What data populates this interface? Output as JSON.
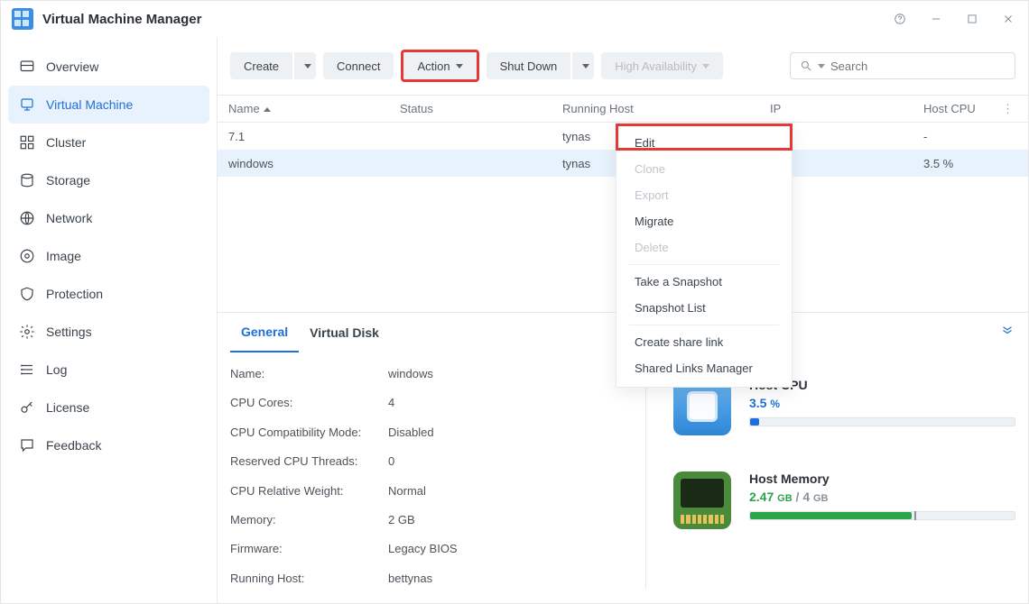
{
  "app": {
    "title": "Virtual Machine Manager"
  },
  "sidebar": {
    "items": [
      {
        "label": "Overview"
      },
      {
        "label": "Virtual Machine"
      },
      {
        "label": "Cluster"
      },
      {
        "label": "Storage"
      },
      {
        "label": "Network"
      },
      {
        "label": "Image"
      },
      {
        "label": "Protection"
      },
      {
        "label": "Settings"
      },
      {
        "label": "Log"
      },
      {
        "label": "License"
      },
      {
        "label": "Feedback"
      }
    ],
    "active_index": 1
  },
  "toolbar": {
    "create": "Create",
    "connect": "Connect",
    "action": "Action",
    "shutdown": "Shut Down",
    "ha": "High Availability",
    "search_placeholder": "Search"
  },
  "action_menu": {
    "items": [
      {
        "label": "Edit",
        "disabled": false
      },
      {
        "label": "Clone",
        "disabled": true
      },
      {
        "label": "Export",
        "disabled": true
      },
      {
        "label": "Migrate",
        "disabled": false
      },
      {
        "label": "Delete",
        "disabled": true
      },
      {
        "sep": true
      },
      {
        "label": "Take a Snapshot",
        "disabled": false
      },
      {
        "label": "Snapshot List",
        "disabled": false
      },
      {
        "sep": true
      },
      {
        "label": "Create share link",
        "disabled": false
      },
      {
        "label": "Shared Links Manager",
        "disabled": false
      }
    ]
  },
  "table": {
    "cols": {
      "name": "Name",
      "status": "Status",
      "host": "Running Host",
      "ip": "IP",
      "cpu": "Host CPU"
    },
    "rows": [
      {
        "name": "7.1",
        "host_suffix": "tynas",
        "ip": "-",
        "cpu": "-"
      },
      {
        "name": "windows",
        "host_suffix": "tynas",
        "ip": "-",
        "cpu": "3.5 %"
      }
    ],
    "selected_index": 1
  },
  "tabs": {
    "items": [
      {
        "label": "General"
      },
      {
        "label": "Virtual Disk"
      }
    ],
    "active_index": 0
  },
  "details": {
    "rows": [
      {
        "k": "Name:",
        "v": "windows"
      },
      {
        "k": "CPU Cores:",
        "v": "4"
      },
      {
        "k": "CPU Compatibility Mode:",
        "v": "Disabled"
      },
      {
        "k": "Reserved CPU Threads:",
        "v": "0"
      },
      {
        "k": "CPU Relative Weight:",
        "v": "Normal"
      },
      {
        "k": "Memory:",
        "v": "2 GB"
      },
      {
        "k": "Firmware:",
        "v": "Legacy BIOS"
      },
      {
        "k": "Running Host:",
        "v": "bettynas"
      }
    ]
  },
  "resources": {
    "cpu": {
      "title": "Host CPU",
      "value": "3.5",
      "unit": "%",
      "percent": 3.5
    },
    "mem": {
      "title": "Host Memory",
      "used": "2.47",
      "used_unit": "GB",
      "total": "4",
      "total_unit": "GB",
      "percent": 61
    }
  }
}
